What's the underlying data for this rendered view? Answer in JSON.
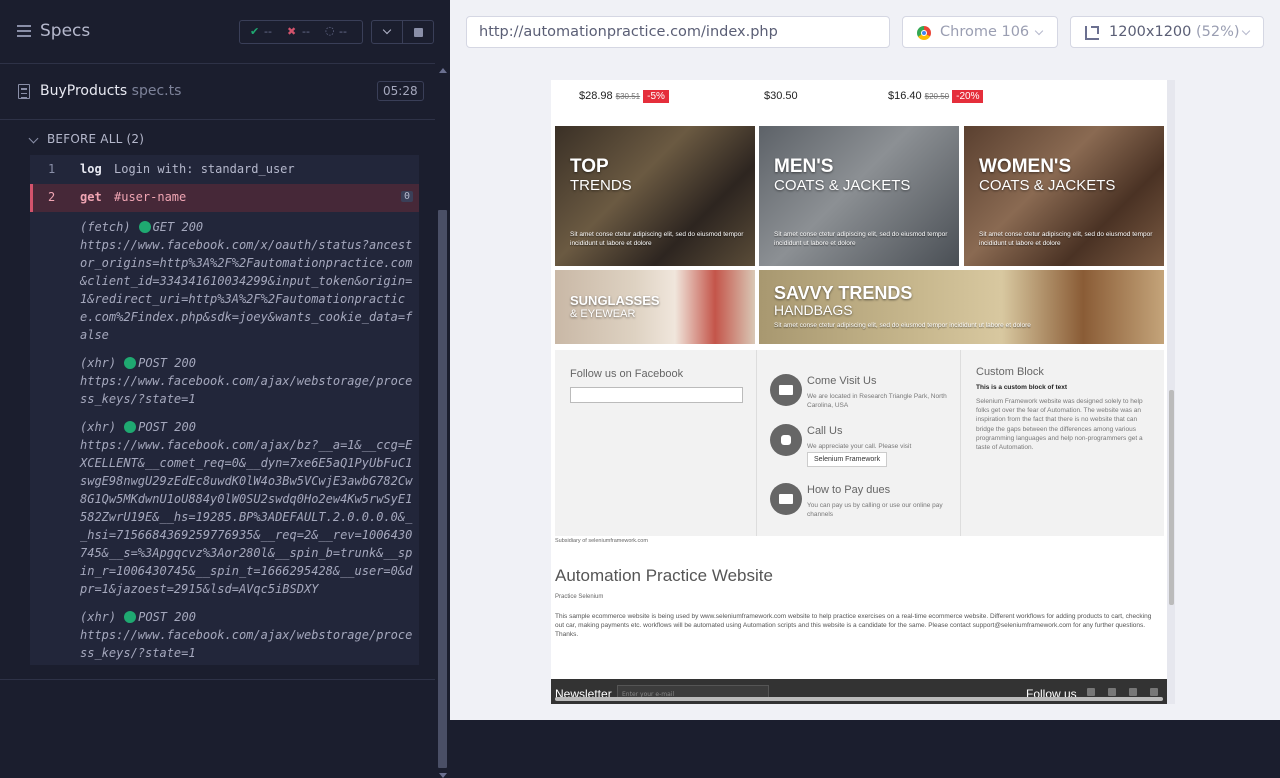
{
  "header": {
    "title": "Specs"
  },
  "stats": {
    "passed": "--",
    "failed": "--",
    "pending": "--"
  },
  "spec": {
    "name": "BuyProducts",
    "ext": "spec.ts",
    "duration": "05:28"
  },
  "hook": {
    "label": "BEFORE ALL (2)"
  },
  "commands": [
    {
      "num": "1",
      "name": "log",
      "message": "Login with: standard_user"
    },
    {
      "num": "2",
      "name": "get",
      "message": "#user-name",
      "badge": "0"
    }
  ],
  "logs": [
    {
      "kind": "(fetch)",
      "method": "GET 200",
      "url": "https://www.facebook.com/x/oauth/status?ancestor_origins=http%3A%2F%2Fautomationpractice.com&client_id=334341610034299&input_token&origin=1&redirect_uri=http%3A%2F%2Fautomationpractice.com%2Findex.php&sdk=joey&wants_cookie_data=false"
    },
    {
      "kind": "(xhr)",
      "method": "POST 200",
      "url": "https://www.facebook.com/ajax/webstorage/process_keys/?state=1"
    },
    {
      "kind": "(xhr)",
      "method": "POST 200",
      "url": "https://www.facebook.com/ajax/bz?__a=1&__ccg=EXCELLENT&__comet_req=0&__dyn=7xe6E5aQ1PyUbFuC1swgE98nwgU29zEdEc8uwdK0lW4o3Bw5VCwjE3awbG782Cw8G1Qw5MKdwnU1oU884y0lW0SU2swdq0Ho2ew4Kw5rwSyE1582ZwrU19E&__hs=19285.BP%3ADEFAULT.2.0.0.0.0&__hsi=7156684369259776935&__req=2&__rev=1006430745&__s=%3Apgqcvz%3Aor280l&__spin_b=trunk&__spin_r=1006430745&__spin_t=1666295428&__user=0&dpr=1&jazoest=2915&lsd=AVqc5iBSDXY"
    },
    {
      "kind": "(xhr)",
      "method": "POST 200",
      "url": "https://www.facebook.com/ajax/webstorage/process_keys/?state=1"
    }
  ],
  "browser": {
    "url": "http://automationpractice.com/index.php",
    "name": "Chrome 106",
    "viewport": "1200x1200",
    "scale": "(52%)"
  },
  "aut": {
    "prices": [
      {
        "price": "$28.98",
        "old": "$30.51",
        "discount": "-5%"
      },
      {
        "price": "$30.50",
        "old": "",
        "discount": ""
      },
      {
        "price": "$16.40",
        "old": "$20.50",
        "discount": "-20%"
      }
    ],
    "banners": [
      {
        "title": "TOP",
        "sub": "TRENDS",
        "text": "Sit amet conse ctetur adipiscing elit, sed do eiusmod tempor incididunt ut labore et dolore"
      },
      {
        "title": "MEN'S",
        "sub": "COATS & JACKETS",
        "text": "Sit amet conse ctetur adipiscing elit, sed do eiusmod tempor incididunt ut labore et dolore"
      },
      {
        "title": "WOMEN'S",
        "sub": "COATS & JACKETS",
        "text": "Sit amet conse ctetur adipiscing elit, sed do eiusmod tempor incididunt ut labore et dolore"
      },
      {
        "title": "SUNGLASSES",
        "sub": "& EYEWEAR",
        "text": ""
      },
      {
        "title": "SAVVY TRENDS",
        "sub": "HANDBAGS",
        "text": "Sit amet conse ctetur adipiscing elit, sed do eiusmod tempor incididunt ut labore et dolore"
      }
    ],
    "facebook": {
      "title": "Follow us on Facebook"
    },
    "contact": [
      {
        "title": "Come Visit Us",
        "text": "We are located in Research Triangle Park, North Carolina, USA"
      },
      {
        "title": "Call Us",
        "text": "We appreciate your call. Please visit",
        "button": "Selenium Framework"
      },
      {
        "title": "How to Pay dues",
        "text": "You can pay us by calling or use our online pay channels"
      }
    ],
    "custom": {
      "title": "Custom Block",
      "subtitle": "This is a custom block of text",
      "body": "Selenium Framework website was designed solely to help folks get over the fear of Automation. The website was an inspiration from the fact that there is no website that can bridge the gaps between the differences among various programming languages and help non-programmers get a taste of Automation."
    },
    "subsidiary": "Subsidiary of seleniumframework.com",
    "site_title": "Automation Practice Website",
    "practice": "Practice Selenium",
    "description": "This sample ecommerce website is being used by www.seleniumframework.com website to help practice exercises on a real-time ecommerce website. Different workflows for adding products to cart, checking out car, making payments etc. workflows will be automated using Automation scripts and this website is a candidate for the same. Please contact support@seleniumframework.com for any further questions. Thanks.",
    "newsletter": "Newsletter",
    "newsletter_placeholder": "Enter your e-mail",
    "follow": "Follow us"
  },
  "colors": {
    "passed": "#1fa971",
    "failed": "#d2536c",
    "discount": "#e52e3b"
  }
}
